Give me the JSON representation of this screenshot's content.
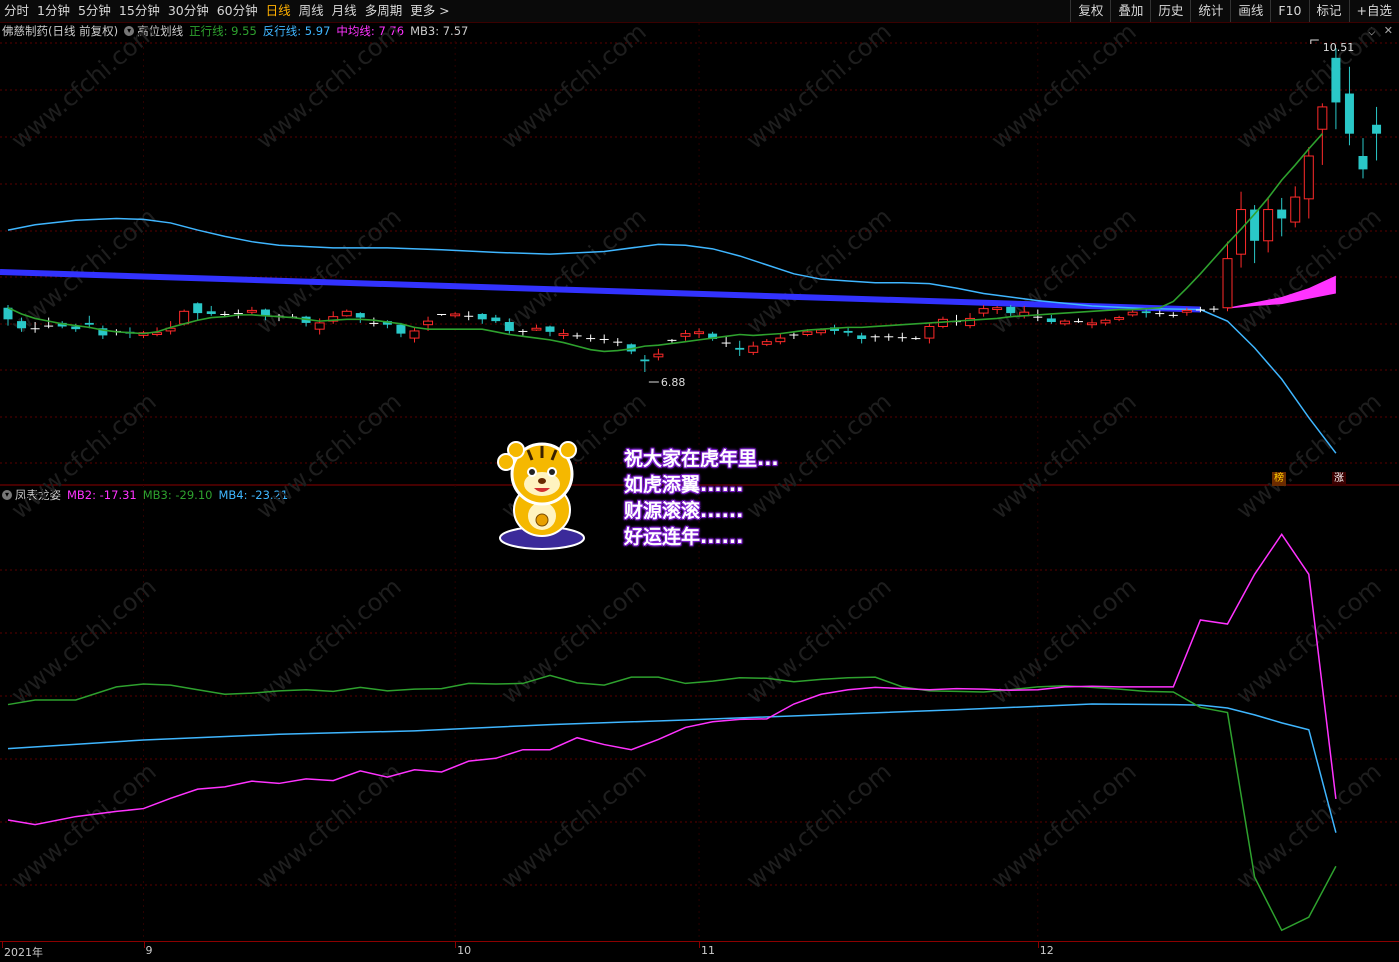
{
  "toolbar": {
    "periods": [
      "分时",
      "1分钟",
      "5分钟",
      "15分钟",
      "30分钟",
      "60分钟",
      "日线",
      "周线",
      "月线",
      "多周期",
      "更多 >"
    ],
    "active_period": "日线",
    "tools": [
      "复权",
      "叠加",
      "历史",
      "统计",
      "画线",
      "F10",
      "标记",
      "+自选"
    ]
  },
  "main_legend": {
    "stock": "佛慈制药(日线 前复权)",
    "indicator": "高位划线",
    "items": [
      {
        "label": "正行线",
        "value": "9.55",
        "color": "#2ea12e"
      },
      {
        "label": "反行线",
        "value": "5.97",
        "color": "#3fb6ff"
      },
      {
        "label": "中均线",
        "value": "7.76",
        "color": "#ff33ff"
      },
      {
        "label": "MB3",
        "value": "7.57",
        "color": "#cccccc"
      }
    ]
  },
  "sub_legend": {
    "indicator": "凤表龙姿",
    "items": [
      {
        "label": "MB2",
        "value": "-17.31",
        "color": "#ff33ff"
      },
      {
        "label": "MB3",
        "value": "-29.10",
        "color": "#2ea12e"
      },
      {
        "label": "MB4",
        "value": "-23.21",
        "color": "#3fb6ff"
      }
    ]
  },
  "greeting": [
    "祝大家在虎年里...",
    "如虎添翼......",
    "财源滚滚......",
    "好运连年......"
  ],
  "chart_data": {
    "type": "candlestick",
    "ylim": [
      5.2,
      11.2
    ],
    "colors": {
      "up": "#ff2a2a",
      "down": "#2ac8c8",
      "zheng": "#2ea12e",
      "fan": "#3fb6ff",
      "mid": "#ff33ff",
      "thick": "#3232ff"
    },
    "candles": [
      [
        7.6,
        7.47,
        7.63,
        7.4
      ],
      [
        7.45,
        7.37,
        7.49,
        7.33
      ],
      [
        7.37,
        7.36,
        7.44,
        7.32
      ],
      [
        7.39,
        7.4,
        7.49,
        7.37
      ],
      [
        7.43,
        7.39,
        7.45,
        7.37
      ],
      [
        7.39,
        7.36,
        7.42,
        7.33
      ],
      [
        7.43,
        7.41,
        7.51,
        7.37
      ],
      [
        7.37,
        7.29,
        7.4,
        7.25
      ],
      [
        7.34,
        7.33,
        7.36,
        7.29
      ],
      [
        7.33,
        7.31,
        7.38,
        7.26
      ],
      [
        7.29,
        7.32,
        7.34,
        7.26
      ],
      [
        7.3,
        7.32,
        7.38,
        7.28
      ],
      [
        7.34,
        7.37,
        7.45,
        7.3
      ],
      [
        7.42,
        7.56,
        7.58,
        7.4
      ],
      [
        7.65,
        7.54,
        7.66,
        7.46
      ],
      [
        7.56,
        7.53,
        7.62,
        7.51
      ],
      [
        7.53,
        7.53,
        7.56,
        7.5
      ],
      [
        7.54,
        7.53,
        7.58,
        7.48
      ],
      [
        7.55,
        7.57,
        7.61,
        7.52
      ],
      [
        7.58,
        7.51,
        7.59,
        7.46
      ],
      [
        7.51,
        7.5,
        7.53,
        7.45
      ],
      [
        7.5,
        7.5,
        7.53,
        7.48
      ],
      [
        7.5,
        7.43,
        7.51,
        7.39
      ],
      [
        7.36,
        7.43,
        7.48,
        7.3
      ],
      [
        7.45,
        7.5,
        7.56,
        7.42
      ],
      [
        7.51,
        7.56,
        7.58,
        7.5
      ],
      [
        7.54,
        7.49,
        7.55,
        7.43
      ],
      [
        7.43,
        7.42,
        7.49,
        7.39
      ],
      [
        7.45,
        7.41,
        7.46,
        7.37
      ],
      [
        7.41,
        7.31,
        7.43,
        7.27
      ],
      [
        7.26,
        7.34,
        7.38,
        7.21
      ],
      [
        7.41,
        7.45,
        7.5,
        7.34
      ],
      [
        7.53,
        7.52,
        7.53,
        7.51
      ],
      [
        7.51,
        7.53,
        7.55,
        7.49
      ],
      [
        7.51,
        7.5,
        7.56,
        7.46
      ],
      [
        7.53,
        7.47,
        7.54,
        7.42
      ],
      [
        7.49,
        7.45,
        7.52,
        7.43
      ],
      [
        7.44,
        7.34,
        7.48,
        7.31
      ],
      [
        7.34,
        7.33,
        7.36,
        7.29
      ],
      [
        7.35,
        7.37,
        7.41,
        7.34
      ],
      [
        7.39,
        7.33,
        7.4,
        7.28
      ],
      [
        7.29,
        7.31,
        7.36,
        7.25
      ],
      [
        7.29,
        7.28,
        7.32,
        7.25
      ],
      [
        7.26,
        7.26,
        7.3,
        7.22
      ],
      [
        7.25,
        7.25,
        7.3,
        7.2
      ],
      [
        7.22,
        7.22,
        7.26,
        7.17
      ],
      [
        7.19,
        7.11,
        7.2,
        7.08
      ],
      [
        7.02,
        7.0,
        7.07,
        6.88
      ],
      [
        7.05,
        7.08,
        7.14,
        7.01
      ],
      [
        7.24,
        7.24,
        7.25,
        7.21
      ],
      [
        7.28,
        7.31,
        7.35,
        7.23
      ],
      [
        7.31,
        7.33,
        7.37,
        7.26
      ],
      [
        7.31,
        7.25,
        7.33,
        7.23
      ],
      [
        7.21,
        7.2,
        7.28,
        7.16
      ],
      [
        7.15,
        7.13,
        7.23,
        7.06
      ],
      [
        7.1,
        7.17,
        7.22,
        7.07
      ],
      [
        7.19,
        7.22,
        7.25,
        7.17
      ],
      [
        7.22,
        7.26,
        7.31,
        7.19
      ],
      [
        7.29,
        7.3,
        7.32,
        7.25
      ],
      [
        7.3,
        7.33,
        7.36,
        7.28
      ],
      [
        7.32,
        7.35,
        7.37,
        7.29
      ],
      [
        7.38,
        7.34,
        7.41,
        7.3
      ],
      [
        7.34,
        7.32,
        7.38,
        7.28
      ],
      [
        7.29,
        7.25,
        7.32,
        7.2
      ],
      [
        7.27,
        7.28,
        7.3,
        7.22
      ],
      [
        7.28,
        7.28,
        7.31,
        7.23
      ],
      [
        7.26,
        7.27,
        7.32,
        7.22
      ],
      [
        7.25,
        7.26,
        7.28,
        7.24
      ],
      [
        7.26,
        7.39,
        7.43,
        7.2
      ],
      [
        7.39,
        7.47,
        7.5,
        7.37
      ],
      [
        7.45,
        7.44,
        7.52,
        7.4
      ],
      [
        7.4,
        7.48,
        7.54,
        7.37
      ],
      [
        7.54,
        7.59,
        7.63,
        7.5
      ],
      [
        7.58,
        7.6,
        7.62,
        7.53
      ],
      [
        7.61,
        7.54,
        7.63,
        7.49
      ],
      [
        7.51,
        7.55,
        7.62,
        7.48
      ],
      [
        7.5,
        7.49,
        7.58,
        7.45
      ],
      [
        7.48,
        7.44,
        7.52,
        7.42
      ],
      [
        7.42,
        7.45,
        7.47,
        7.4
      ],
      [
        7.45,
        7.45,
        7.48,
        7.43
      ],
      [
        7.41,
        7.43,
        7.48,
        7.37
      ],
      [
        7.43,
        7.46,
        7.48,
        7.4
      ],
      [
        7.47,
        7.49,
        7.51,
        7.45
      ],
      [
        7.52,
        7.55,
        7.57,
        7.5
      ],
      [
        7.56,
        7.54,
        7.58,
        7.49
      ],
      [
        7.54,
        7.53,
        7.57,
        7.5
      ],
      [
        7.52,
        7.52,
        7.55,
        7.49
      ],
      [
        7.55,
        7.57,
        7.6,
        7.51
      ],
      [
        7.58,
        7.58,
        7.61,
        7.55
      ],
      [
        7.58,
        7.59,
        7.62,
        7.55
      ],
      [
        7.6,
        8.15,
        8.34,
        7.56
      ],
      [
        8.2,
        8.7,
        8.9,
        8.05
      ],
      [
        8.7,
        8.35,
        8.75,
        8.1
      ],
      [
        8.35,
        8.7,
        8.84,
        8.22
      ],
      [
        8.7,
        8.6,
        8.83,
        8.4
      ],
      [
        8.56,
        8.84,
        8.96,
        8.5
      ],
      [
        8.82,
        9.3,
        9.4,
        8.6
      ],
      [
        9.6,
        9.85,
        9.89,
        9.2
      ],
      [
        10.4,
        9.9,
        10.51,
        9.6
      ],
      [
        10.0,
        9.55,
        10.3,
        9.42
      ],
      [
        9.3,
        9.15,
        9.5,
        9.05
      ],
      [
        9.65,
        9.55,
        9.85,
        9.25
      ]
    ],
    "zheng": [
      7.6,
      7.53,
      7.48,
      7.45,
      7.42,
      7.4,
      7.38,
      7.35,
      7.33,
      7.32,
      7.31,
      7.33,
      7.38,
      7.42,
      7.46,
      7.49,
      7.5,
      7.52,
      7.52,
      7.51,
      7.5,
      7.49,
      7.47,
      7.45,
      7.46,
      7.47,
      7.47,
      7.46,
      7.44,
      7.42,
      7.38,
      7.36,
      7.36,
      7.36,
      7.36,
      7.36,
      7.33,
      7.3,
      7.28,
      7.26,
      7.24,
      7.21,
      7.17,
      7.13,
      7.11,
      7.12,
      7.14,
      7.17,
      7.18,
      7.2,
      7.22,
      7.24,
      7.26,
      7.28,
      7.3,
      7.29,
      7.3,
      7.31,
      7.33,
      7.35,
      7.36,
      7.37,
      7.38,
      7.38,
      7.39,
      7.4,
      7.41,
      7.42,
      7.43,
      7.44,
      7.45,
      7.46,
      7.47,
      7.48,
      7.5,
      7.51,
      7.52,
      7.53,
      7.54,
      7.55,
      7.56,
      7.57,
      7.58,
      7.58,
      7.59,
      7.6,
      7.67,
      7.82,
      7.98,
      8.15,
      8.32,
      8.48,
      8.65,
      8.83,
      9.03,
      9.2,
      9.38,
      9.55
    ],
    "fan_x": [
      0,
      2,
      5,
      8,
      10,
      12,
      14,
      16,
      18,
      20,
      24,
      28,
      32,
      36,
      40,
      44,
      48,
      50,
      52,
      54,
      56,
      58,
      60,
      62,
      64,
      66,
      68,
      70,
      72,
      76,
      80,
      84,
      88,
      90,
      92,
      94,
      96,
      98
    ],
    "fan": [
      8.47,
      8.53,
      8.58,
      8.6,
      8.59,
      8.55,
      8.47,
      8.4,
      8.34,
      8.3,
      8.27,
      8.27,
      8.25,
      8.22,
      8.2,
      8.23,
      8.31,
      8.3,
      8.26,
      8.18,
      8.08,
      7.98,
      7.92,
      7.9,
      7.88,
      7.88,
      7.87,
      7.82,
      7.76,
      7.68,
      7.62,
      7.59,
      7.58,
      7.45,
      7.15,
      6.8,
      6.37,
      5.97
    ],
    "mid_x": [
      90,
      92,
      94,
      96,
      98
    ],
    "mid_upper": [
      7.6,
      7.66,
      7.72,
      7.82,
      7.96
    ],
    "mid_lower": [
      7.59,
      7.62,
      7.64,
      7.7,
      7.76
    ],
    "thick": [
      8.0,
      7.58
    ],
    "sub_ylim": [
      -42,
      35
    ],
    "sub": {
      "mb2_x": [
        0,
        2,
        5,
        8,
        10,
        12,
        14,
        16,
        18,
        20,
        22,
        24,
        26,
        28,
        30,
        32,
        34,
        36,
        38,
        40,
        42,
        44,
        46,
        48,
        50,
        52,
        54,
        56,
        58,
        60,
        62,
        64,
        66,
        68,
        70,
        72,
        74,
        76,
        78,
        80,
        82,
        84,
        86,
        88,
        90,
        92,
        94,
        96,
        98
      ],
      "mb2": [
        -21.0,
        -21.8,
        -20.4,
        -19.5,
        -19.0,
        -17.2,
        -15.6,
        -15.2,
        -14.2,
        -14.6,
        -13.8,
        -14.1,
        -12.4,
        -13.5,
        -12.2,
        -12.6,
        -10.7,
        -10.2,
        -8.7,
        -8.7,
        -6.6,
        -7.8,
        -8.7,
        -6.9,
        -4.8,
        -3.8,
        -3.4,
        -3.3,
        -0.7,
        1.0,
        1.8,
        2.2,
        2.0,
        1.8,
        2.0,
        1.9,
        1.7,
        1.8,
        2.3,
        2.4,
        2.3,
        2.3,
        2.3,
        14.0,
        13.3,
        22.0,
        29.0,
        22.0,
        -17.31
      ],
      "mb3_x": [
        0,
        2,
        5,
        8,
        10,
        12,
        14,
        16,
        18,
        20,
        22,
        24,
        26,
        28,
        30,
        32,
        34,
        36,
        38,
        40,
        42,
        44,
        46,
        48,
        50,
        52,
        54,
        56,
        58,
        60,
        62,
        64,
        66,
        68,
        70,
        72,
        74,
        76,
        78,
        80,
        82,
        84,
        86,
        88,
        90,
        92,
        94,
        96,
        98
      ],
      "mb3": [
        -0.8,
        0.0,
        0.0,
        2.3,
        2.8,
        2.6,
        1.8,
        1.0,
        1.2,
        1.6,
        1.8,
        1.5,
        2.2,
        1.6,
        1.9,
        2.0,
        2.9,
        2.8,
        2.9,
        4.3,
        3.0,
        2.6,
        4.0,
        4.0,
        2.9,
        3.3,
        3.9,
        3.8,
        3.2,
        3.6,
        3.9,
        4.0,
        2.3,
        1.6,
        1.5,
        1.4,
        1.8,
        2.3,
        2.5,
        2.2,
        1.9,
        1.5,
        1.4,
        -1.3,
        -2.2,
        -31.0,
        -40.3,
        -38.0,
        -29.1
      ],
      "mb4_x": [
        0,
        10,
        20,
        30,
        40,
        50,
        60,
        70,
        80,
        86,
        88,
        90,
        92,
        94,
        96,
        98
      ],
      "mb4": [
        -8.5,
        -7.0,
        -6.0,
        -5.4,
        -4.3,
        -3.5,
        -2.6,
        -1.7,
        -0.7,
        -0.8,
        -0.9,
        -1.4,
        -2.6,
        -4.0,
        -5.2,
        -23.21
      ]
    }
  },
  "x_axis": [
    {
      "label": "2021年",
      "pos": 0
    },
    {
      "label": "9",
      "pos": 10
    },
    {
      "label": "10",
      "pos": 33
    },
    {
      "label": "11",
      "pos": 51
    },
    {
      "label": "12",
      "pos": 76
    }
  ],
  "annotations": {
    "high": "10.51",
    "low": "6.88"
  },
  "badges": [
    "榜",
    "涨"
  ],
  "watermark": "www.cfchi.com"
}
